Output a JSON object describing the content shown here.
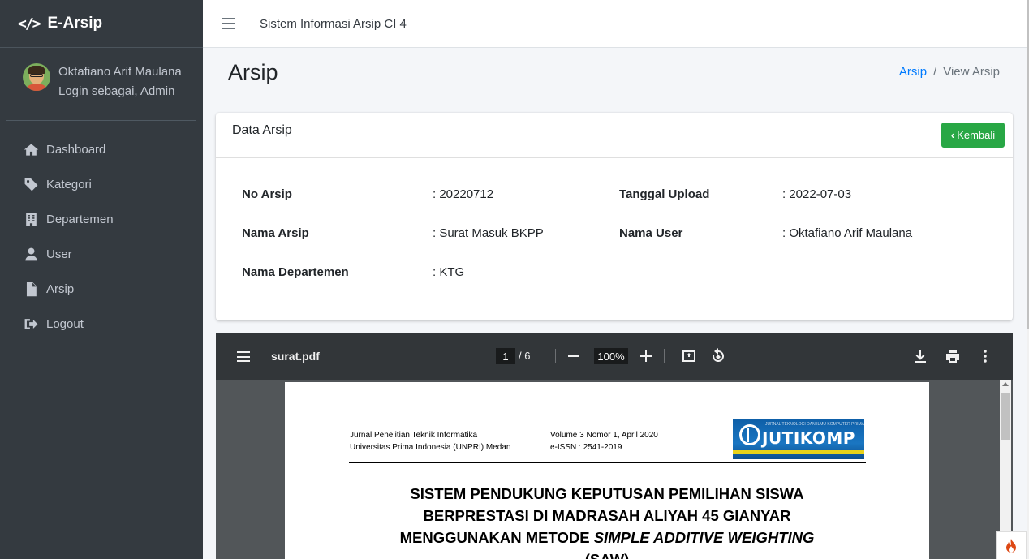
{
  "brand": {
    "name": "E-Arsip"
  },
  "user": {
    "name": "Oktafiano Arif Maulana",
    "role": "Login sebagai, Admin"
  },
  "sidebar": {
    "items": [
      {
        "label": "Dashboard",
        "icon": "home-icon"
      },
      {
        "label": "Kategori",
        "icon": "tag-icon"
      },
      {
        "label": "Departemen",
        "icon": "building-icon"
      },
      {
        "label": "User",
        "icon": "user-icon"
      },
      {
        "label": "Arsip",
        "icon": "file-icon"
      },
      {
        "label": "Logout",
        "icon": "logout-icon"
      }
    ]
  },
  "topbar": {
    "title": "Sistem Informasi Arsip CI 4"
  },
  "page": {
    "title": "Arsip"
  },
  "breadcrumb": {
    "link": "Arsip",
    "sep": "/",
    "current": "View Arsip"
  },
  "card": {
    "title": "Data Arsip",
    "back_label": "Kembali",
    "fields": {
      "no_arsip": {
        "label": "No Arsip",
        "value": ": 20220712"
      },
      "nama_arsip": {
        "label": "Nama Arsip",
        "value": ": Surat Masuk BKPP"
      },
      "nama_departemen": {
        "label": "Nama Departemen",
        "value": ": KTG"
      },
      "tanggal_upload": {
        "label": "Tanggal Upload",
        "value": ": 2022-07-03"
      },
      "nama_user": {
        "label": "Nama User",
        "value": ": Oktafiano Arif Maulana"
      }
    }
  },
  "pdf": {
    "filename": "surat.pdf",
    "current_page": "1",
    "total_pages": "/ 6",
    "zoom": "100%",
    "header_left_1": "Jurnal Penelitian Teknik Informatika",
    "header_left_2": "Universitas Prima Indonesia (UNPRI) Medan",
    "header_mid_1": "Volume 3 Nomor 1, April 2020",
    "header_mid_2": "e-ISSN : 2541-2019",
    "logo_text": "JUTIKOMP",
    "logo_sub": "JURNAL TEKNOLOGI DAN ILMU KOMPUTER PRIMA",
    "title_line_1": "SISTEM PENDUKUNG KEPUTUSAN PEMILIHAN SISWA",
    "title_line_2": "BERPRESTASI DI MADRASAH ALIYAH 45 GIANYAR",
    "title_line_3_plain": "MENGGUNAKAN METODE ",
    "title_line_3_italic": "SIMPLE ADDITIVE WEIGHTING",
    "title_line_4": "(SAW)"
  },
  "colors": {
    "sidebar_bg": "#343a40",
    "accent": "#007bff",
    "success": "#28a745",
    "pdf_toolbar": "#323639"
  }
}
